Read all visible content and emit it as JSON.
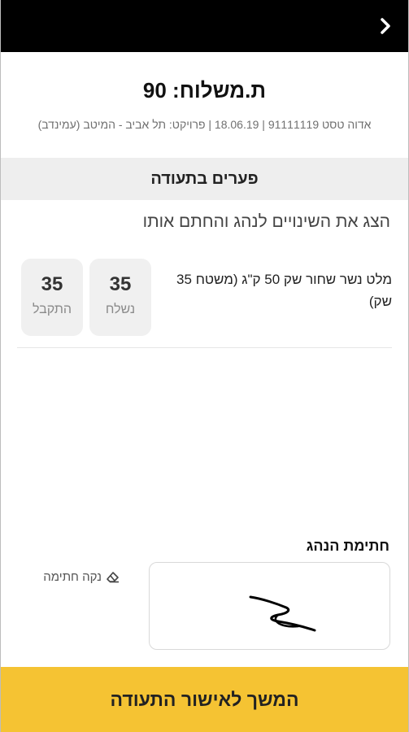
{
  "header": {
    "back_icon": "chevron-right-icon",
    "background": "#000000"
  },
  "delivery": {
    "title": "ת.משלוח: 90",
    "subtitle": "אדוה טסט 91111119 | 18.06.19 | פרויקט: תל אביב - המיטב (עמינדב)"
  },
  "discrepancies": {
    "section_title": "פערים בתעודה",
    "instruction": "הצג את השינויים לנהג והחתם אותו",
    "items": [
      {
        "description": "מלט נשר שחור שק 50 ק\"ג (משטח 35 שק)",
        "sent_value": "35",
        "sent_label": "נשלח",
        "received_value": "35",
        "received_label": "התקבל"
      }
    ]
  },
  "signature": {
    "label": "חתימת הנהג",
    "clear_label": "נקה חתימה",
    "clear_icon": "eraser-icon"
  },
  "footer": {
    "confirm_label": "המשך לאישור התעודה",
    "accent_color": "#f5c333"
  }
}
